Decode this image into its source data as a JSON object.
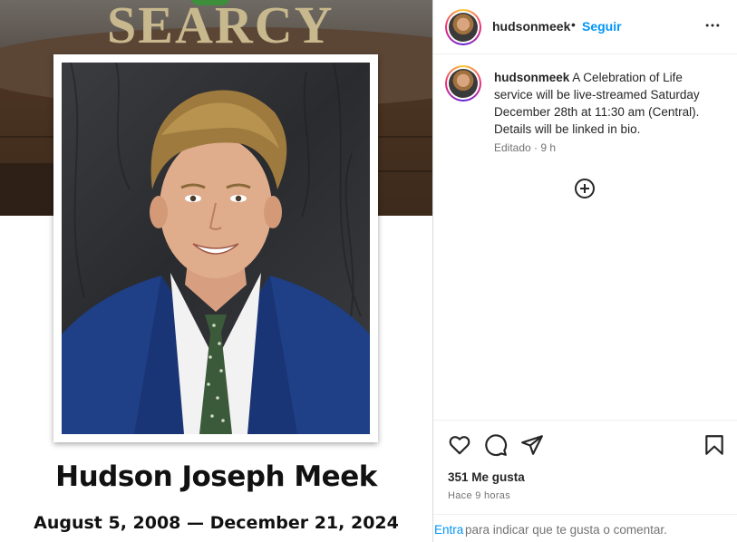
{
  "post_image": {
    "banner_title": "SEARCY",
    "person_name": "Hudson Joseph Meek",
    "dates": "August 5, 2008 — December 21, 2024"
  },
  "header": {
    "username": "hudsonmeek",
    "separator": "•",
    "follow_label": "Seguir",
    "more_icon": "more-options-icon"
  },
  "caption": {
    "username": "hudsonmeek",
    "text": "A Celebration of Life service will be live-streamed Saturday December 28th at 11:30 am (Central). Details will be linked in bio.",
    "meta": "Editado · 9 h"
  },
  "actions": {
    "icons": [
      "heart-icon",
      "comment-icon",
      "share-icon",
      "bookmark-icon",
      "add-circle-icon"
    ],
    "likes": "351 Me gusta",
    "time_ago": "Hace 9 horas"
  },
  "login": {
    "link": "Entra",
    "text": "para indicar que te gusta o comentar."
  }
}
